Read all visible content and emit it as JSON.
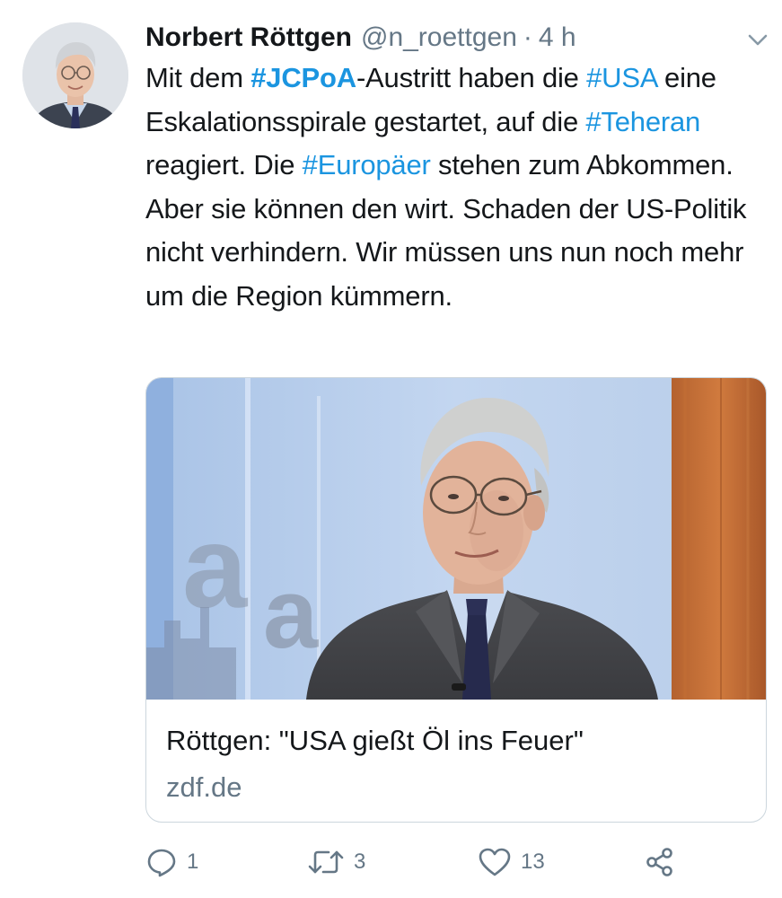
{
  "tweet": {
    "author_name": "Norbert Röttgen",
    "handle": "@n_roettgen",
    "separator": "·",
    "time": "4 h",
    "text_segments": [
      {
        "text": "Mit dem ",
        "type": "text"
      },
      {
        "text": "#JCPoA",
        "type": "hashtag-bold"
      },
      {
        "text": "-Austritt haben die ",
        "type": "text"
      },
      {
        "text": "#USA",
        "type": "hashtag"
      },
      {
        "text": " eine Eskalationsspirale gestartet, auf die ",
        "type": "text"
      },
      {
        "text": "#Teheran",
        "type": "hashtag"
      },
      {
        "text": " reagiert. Die ",
        "type": "text"
      },
      {
        "text": "#Europäer",
        "type": "hashtag"
      },
      {
        "text": " stehen zum Abkommen. Aber sie können den wirt. Schaden der US-Politik nicht verhindern. Wir müssen uns nun noch mehr um die Region kümmern.",
        "type": "text"
      }
    ]
  },
  "card": {
    "title": "Röttgen: \"USA gießt Öl ins Feuer\"",
    "domain": "zdf.de"
  },
  "actions": {
    "reply_count": "1",
    "retweet_count": "3",
    "like_count": "13"
  },
  "icons": {
    "reply": "reply-icon",
    "retweet": "retweet-icon",
    "like": "heart-icon",
    "share": "share-icon",
    "menu": "chevron-down-icon"
  },
  "colors": {
    "hashtag": "#1b95e0",
    "secondary_text": "#657786",
    "primary_text": "#14171a",
    "card_border": "#ccd6dd"
  }
}
